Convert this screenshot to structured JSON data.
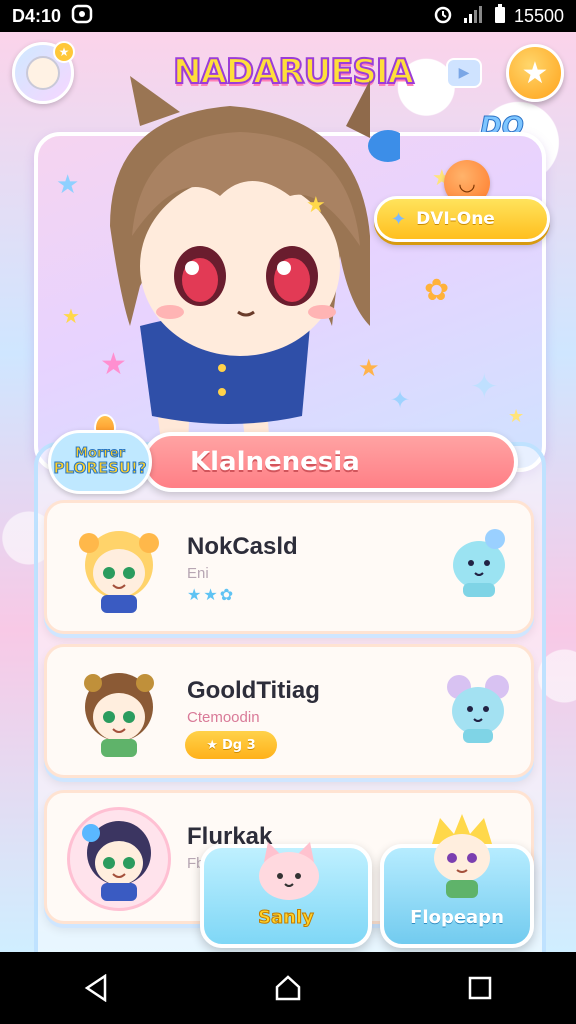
{
  "status_bar": {
    "time": "D4:10",
    "right_text": "15500",
    "icons": [
      "notification-icon",
      "alarm-icon",
      "signal-icon",
      "battery-icon"
    ]
  },
  "header": {
    "title": "NADARUESIA",
    "badge": "DO",
    "icons": [
      "profile-avatar",
      "video-icon",
      "star-icon"
    ]
  },
  "hero": {
    "chip_label": "DVI-One"
  },
  "section": {
    "badge_line1": "Morrer",
    "badge_line2": "PLORESU!?",
    "banner_title": "Klalnenesia"
  },
  "list": [
    {
      "title": "NokCasld",
      "subtitle": "Eni",
      "accent": "#5fc3f3"
    },
    {
      "title": "GooldTitiag",
      "subtitle": "Ctemoodin",
      "tag": "Dg 3",
      "accent": "#ffb11a"
    },
    {
      "title": "Flurkak",
      "subtitle": "Fb",
      "accent": "#ff9fc6"
    }
  ],
  "actions": {
    "left_label": "Sanly",
    "right_label": "Flopeapn"
  },
  "colors": {
    "accent_yellow": "#ffc83a",
    "banner_pink": "#ff7f86",
    "panel_blue": "#bfe2ff"
  }
}
